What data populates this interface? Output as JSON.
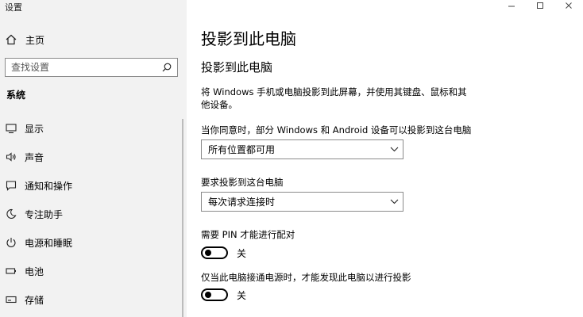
{
  "window": {
    "title": "设置"
  },
  "sidebar": {
    "home_label": "主页",
    "search_placeholder": "查找设置",
    "section_label": "系统",
    "items": [
      {
        "label": "显示",
        "icon": "display-icon"
      },
      {
        "label": "声音",
        "icon": "speaker-icon"
      },
      {
        "label": "通知和操作",
        "icon": "notification-icon"
      },
      {
        "label": "专注助手",
        "icon": "moon-icon"
      },
      {
        "label": "电源和睡眠",
        "icon": "power-icon"
      },
      {
        "label": "电池",
        "icon": "battery-icon"
      },
      {
        "label": "存储",
        "icon": "storage-icon"
      }
    ]
  },
  "main": {
    "page_title": "投影到此电脑",
    "section_title": "投影到此电脑",
    "description": "将 Windows 手机或电脑投影到此屏幕，并使用其键盘、鼠标和其他设备。",
    "availability_label": "当你同意时，部分 Windows 和 Android 设备可以投影到这台电脑",
    "availability_value": "所有位置都可用",
    "request_label": "要求投影到这台电脑",
    "request_value": "每次请求连接时",
    "pin_label": "需要 PIN 才能进行配对",
    "pin_state": "关",
    "power_label": "仅当此电脑接通电源时，才能发现此电脑以进行投影",
    "power_state": "关"
  },
  "colors": {
    "sidebar_bg": "#f2f2f2",
    "main_bg": "#ffffff",
    "border": "#8a8a8a"
  }
}
